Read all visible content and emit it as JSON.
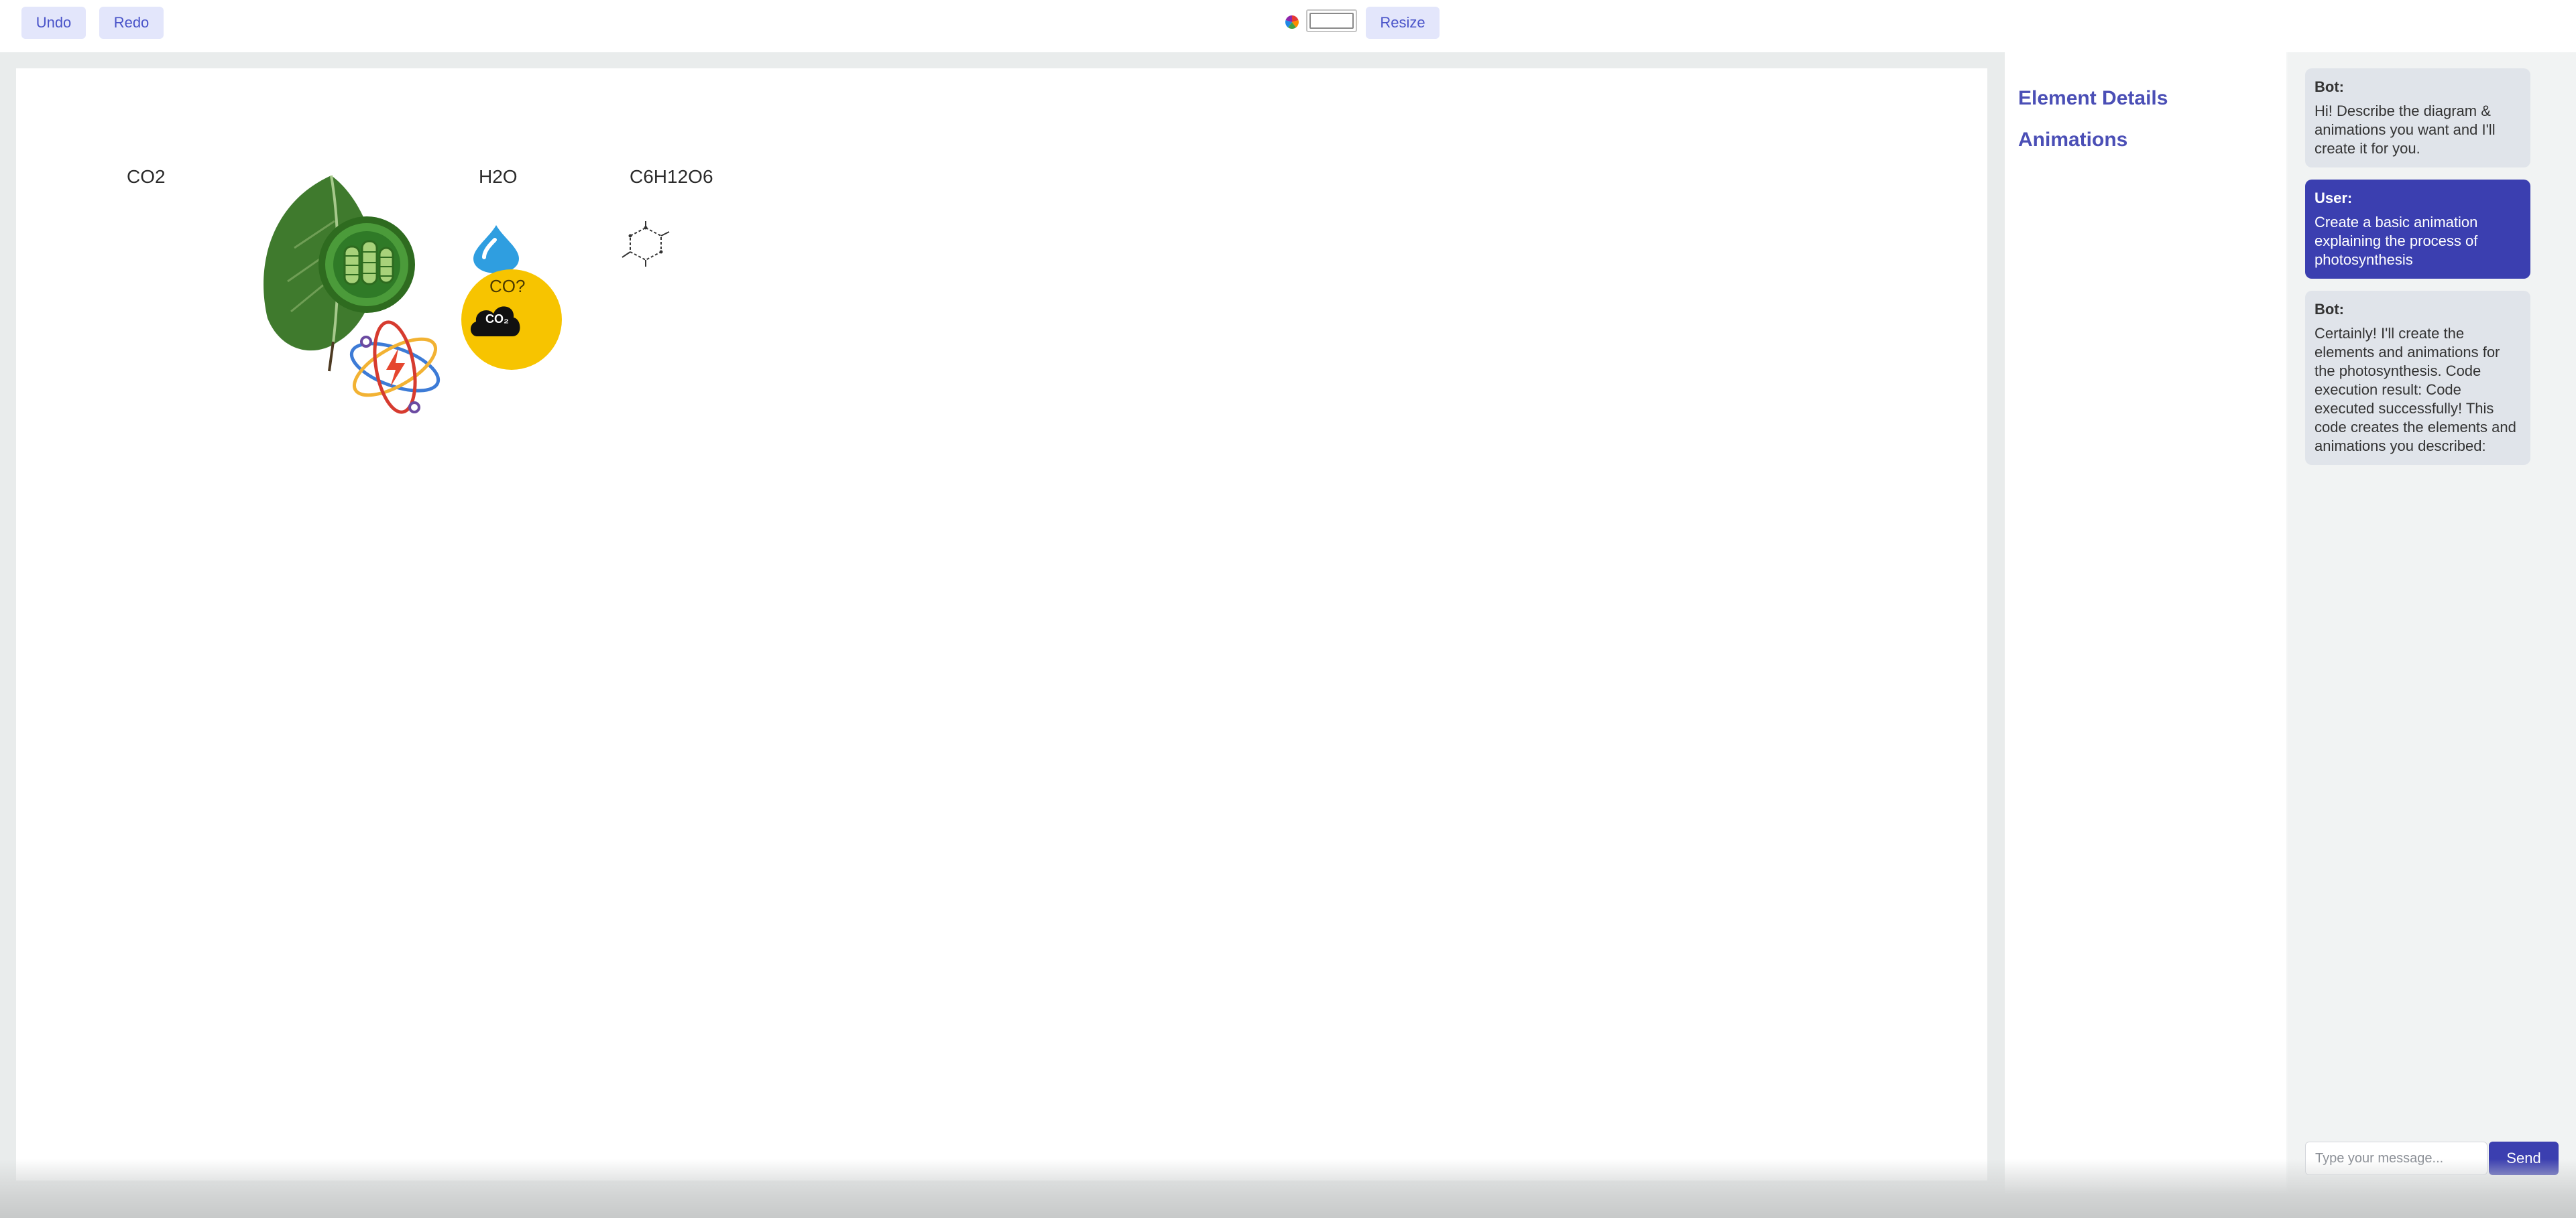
{
  "toolbar": {
    "undo_label": "Undo",
    "redo_label": "Redo",
    "resize_label": "Resize"
  },
  "canvas": {
    "labels": {
      "co2": "CO2",
      "h2o": "H2O",
      "glucose": "C6H12O6",
      "sun_text": "CO?"
    },
    "cloud_text": "CO₂",
    "colors": {
      "leaf": "#3f7a2d",
      "chloroplast": "#4b9b3a",
      "water": "#2f9ee0",
      "sun": "#f7c400"
    }
  },
  "details": {
    "element_details_label": "Element Details",
    "animations_label": "Animations"
  },
  "chat": {
    "messages": [
      {
        "role": "bot",
        "sender": "Bot:",
        "text": "Hi! Describe the diagram & animations you want and I'll create it for you."
      },
      {
        "role": "user",
        "sender": "User:",
        "text": "Create a basic animation explaining the process of photosynthesis"
      },
      {
        "role": "bot",
        "sender": "Bot:",
        "text": "Certainly! I'll create the elements and animations for the photosynthesis. Code execution result: Code executed successfully! This code creates the elements and animations you described:"
      }
    ],
    "input_placeholder": "Type your message...",
    "send_label": "Send",
    "colors": {
      "user_bubble": "#3b3fb0",
      "bot_bubble": "#e0e4ea"
    }
  }
}
